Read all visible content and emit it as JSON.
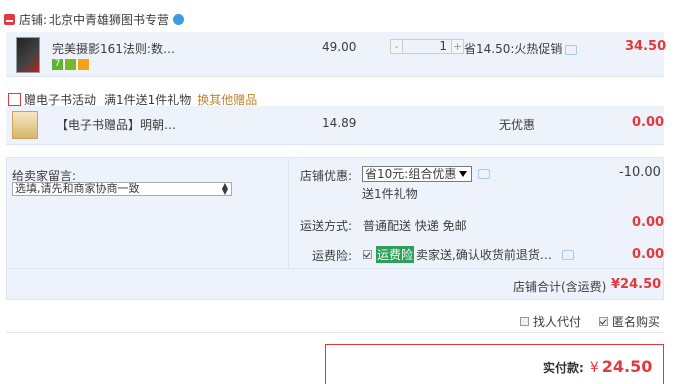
{
  "shop": {
    "prefix": "店铺:",
    "name": "北京中青雄狮图书专营"
  },
  "item1": {
    "title": "完美摄影161法则:数…",
    "badges": [
      "7",
      "",
      ""
    ],
    "price": "49.00",
    "qty_minus": "-",
    "qty": "1",
    "qty_plus": "+",
    "promo": "省14.50:火热促销",
    "subtotal": "34.50"
  },
  "gift_activity": {
    "label": "赠电子书活动",
    "desc": "满1件送1件礼物",
    "change_link": "换其他赠品"
  },
  "item2": {
    "title": "【电子书赠品】明朝…",
    "price": "14.89",
    "promo": "无优惠",
    "subtotal": "0.00"
  },
  "message": {
    "label": "给卖家留言:",
    "placeholder": "选填,请先和商家协商一致"
  },
  "shop_discount": {
    "label": "店铺优惠:",
    "selected": "省10元:组合优惠",
    "gift": "送1件礼物",
    "amount": "-10.00"
  },
  "shipping": {
    "label": "运送方式:",
    "method": "普通配送 快递 免邮",
    "amount": "0.00"
  },
  "insurance": {
    "label": "运费险:",
    "tag": "运费险",
    "desc": "卖家送,确认收货前退货…",
    "amount": "0.00"
  },
  "shop_total": {
    "label": "店铺合计(含运费)",
    "amount": "¥24.50"
  },
  "options": {
    "proxy_pay": "找人代付",
    "anonymous": "匿名购买",
    "anonymous_checked": true,
    "proxy_checked": false
  },
  "payment": {
    "label": "实付款:",
    "currency": "¥",
    "amount": "24.50"
  },
  "colors": {
    "accent": "#e4393c",
    "row_bg": "#eef3fb",
    "tag_green": "#2e9e5b"
  }
}
